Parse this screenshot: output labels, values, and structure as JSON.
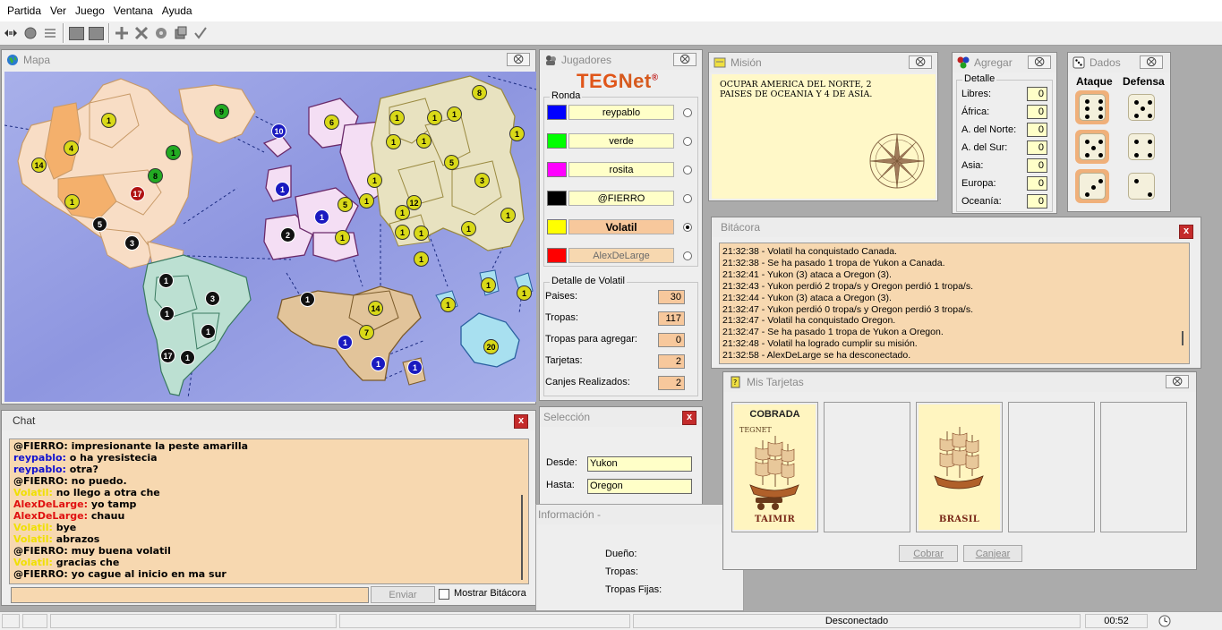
{
  "menu": [
    "Partida",
    "Ver",
    "Juego",
    "Ventana",
    "Ayuda"
  ],
  "toolbar": {
    "buttons": [
      "connect-icon",
      "start-icon",
      "list-icon",
      "stop-icon",
      "stop2-icon",
      "add-icon",
      "cancel-icon",
      "settings-icon",
      "copy-icon",
      "check-icon"
    ]
  },
  "map": {
    "title": "Mapa",
    "close_label": "⨂",
    "armies": [
      {
        "n": "1",
        "c": "y"
      },
      {
        "n": "9",
        "c": "g"
      },
      {
        "n": "4",
        "c": "y"
      },
      {
        "n": "14",
        "c": "y"
      },
      {
        "n": "1",
        "c": "g"
      },
      {
        "n": "8",
        "c": "g"
      },
      {
        "n": "1",
        "c": "y"
      },
      {
        "n": "17",
        "c": "r"
      },
      {
        "n": "5",
        "c": "k"
      },
      {
        "n": "3",
        "c": "k"
      },
      {
        "n": "10",
        "c": "b"
      },
      {
        "n": "1",
        "c": "b"
      },
      {
        "n": "6",
        "c": "y"
      },
      {
        "n": "1",
        "c": "y"
      },
      {
        "n": "1",
        "c": "y"
      },
      {
        "n": "1",
        "c": "y"
      },
      {
        "n": "8",
        "c": "y"
      },
      {
        "n": "1",
        "c": "y"
      },
      {
        "n": "1",
        "c": "y"
      },
      {
        "n": "1",
        "c": "y"
      },
      {
        "n": "5",
        "c": "y"
      },
      {
        "n": "1",
        "c": "y"
      },
      {
        "n": "3",
        "c": "y"
      },
      {
        "n": "12",
        "c": "y"
      },
      {
        "n": "1",
        "c": "y"
      },
      {
        "n": "5",
        "c": "y"
      },
      {
        "n": "1",
        "c": "y"
      },
      {
        "n": "1",
        "c": "b"
      },
      {
        "n": "1",
        "c": "y"
      },
      {
        "n": "1",
        "c": "y"
      },
      {
        "n": "1",
        "c": "y"
      },
      {
        "n": "1",
        "c": "y"
      },
      {
        "n": "1",
        "c": "y"
      },
      {
        "n": "2",
        "c": "k"
      },
      {
        "n": "1",
        "c": "y"
      },
      {
        "n": "1",
        "c": "k"
      },
      {
        "n": "3",
        "c": "k"
      },
      {
        "n": "1",
        "c": "k"
      },
      {
        "n": "1",
        "c": "k"
      },
      {
        "n": "17",
        "c": "k"
      },
      {
        "n": "1",
        "c": "k"
      },
      {
        "n": "1",
        "c": "k"
      },
      {
        "n": "14",
        "c": "y"
      },
      {
        "n": "7",
        "c": "y"
      },
      {
        "n": "1",
        "c": "b"
      },
      {
        "n": "1",
        "c": "b"
      },
      {
        "n": "1",
        "c": "b"
      },
      {
        "n": "1",
        "c": "y"
      },
      {
        "n": "1",
        "c": "y"
      },
      {
        "n": "1",
        "c": "y"
      },
      {
        "n": "20",
        "c": "y"
      }
    ]
  },
  "chat": {
    "title": "Chat",
    "close_label": "x",
    "lines": [
      {
        "nick": "@FIERRO:",
        "color": "#000000",
        "text": " impresionante la peste amarilla"
      },
      {
        "nick": "reypablo:",
        "color": "#1010d0",
        "text": " o ha yresistecia"
      },
      {
        "nick": "reypablo:",
        "color": "#1010d0",
        "text": " otra?"
      },
      {
        "nick": "@FIERRO:",
        "color": "#000000",
        "text": " no puedo."
      },
      {
        "nick": "Volatil:",
        "color": "#f0e000",
        "text": " no llego a otra che"
      },
      {
        "nick": "AlexDeLarge:",
        "color": "#e01010",
        "text": " yo tamp"
      },
      {
        "nick": "AlexDeLarge:",
        "color": "#e01010",
        "text": " chauu"
      },
      {
        "nick": "Volatil:",
        "color": "#f0e000",
        "text": " bye"
      },
      {
        "nick": "Volatil:",
        "color": "#f0e000",
        "text": " abrazos"
      },
      {
        "nick": "@FIERRO:",
        "color": "#000000",
        "text": " muy buena volatil"
      },
      {
        "nick": "Volatil:",
        "color": "#f0e000",
        "text": " gracias che"
      },
      {
        "nick": "@FIERRO:",
        "color": "#000000",
        "text": " yo cague al inicio en ma sur"
      }
    ],
    "input_value": "",
    "send_label": "Enviar",
    "show_log_label": "Mostrar Bitácora"
  },
  "players": {
    "title": "Jugadores",
    "close_label": "⨂",
    "logo_teg": "TEG",
    "logo_net": "Net",
    "logo_mark": "®",
    "round_label": "Ronda",
    "list": [
      {
        "name": "reypablo",
        "color": "#0000ff",
        "style": "normal",
        "selected": false
      },
      {
        "name": "verde",
        "color": "#00ff00",
        "style": "normal",
        "selected": false
      },
      {
        "name": "rosita",
        "color": "#ff00ff",
        "style": "normal",
        "selected": false
      },
      {
        "name": "@FIERRO",
        "color": "#000000",
        "style": "normal",
        "selected": false
      },
      {
        "name": "Volatil",
        "color": "#ffff00",
        "style": "active",
        "selected": true
      },
      {
        "name": "AlexDeLarge",
        "color": "#ff0000",
        "style": "dim",
        "selected": false
      }
    ],
    "detail_label": "Detalle de Volatil",
    "detail": [
      {
        "label": "Paises:",
        "value": "30"
      },
      {
        "label": "Tropas:",
        "value": "117"
      },
      {
        "label": "Tropas para agregar:",
        "value": "0"
      },
      {
        "label": "Tarjetas:",
        "value": "2"
      },
      {
        "label": "Canjes Realizados:",
        "value": "2"
      }
    ]
  },
  "selection": {
    "title": "Selección",
    "close_label": "x",
    "from_label": "Desde:",
    "from_value": "Yukon",
    "to_label": "Hasta:",
    "to_value": "Oregon"
  },
  "info": {
    "title": "Información -",
    "owner_label": "Dueño:",
    "troops_label": "Tropas:",
    "fixed_label": "Tropas Fijas:"
  },
  "mission": {
    "title": "Misión",
    "close_label": "⨂",
    "text": "OCUPAR AMERICA DEL NORTE, 2 PAISES DE OCEANIA Y 4 DE ASIA."
  },
  "add": {
    "title": "Agregar",
    "close_label": "⨂",
    "detail_label": "Detalle",
    "rows": [
      {
        "label": "Libres:",
        "value": "0"
      },
      {
        "label": "África:",
        "value": "0"
      },
      {
        "label": "A. del Norte:",
        "value": "0"
      },
      {
        "label": "A. del Sur:",
        "value": "0"
      },
      {
        "label": "Asia:",
        "value": "0"
      },
      {
        "label": "Europa:",
        "value": "0"
      },
      {
        "label": "Oceanía:",
        "value": "0"
      }
    ]
  },
  "dice": {
    "title": "Dados",
    "close_label": "⨂",
    "attack_label": "Ataque",
    "defense_label": "Defensa",
    "attack": [
      6,
      5,
      3
    ],
    "defense": [
      5,
      4,
      2
    ]
  },
  "log": {
    "title": "Bitácora",
    "close_label": "x",
    "lines": [
      "21:32:38 - Volatil ha conquistado Canada.",
      "21:32:38 - Se ha pasado 1 tropa de Yukon a Canada.",
      "21:32:41 - Yukon (3) ataca a Oregon (3).",
      "21:32:43 - Yukon perdió 2 tropa/s y Oregon perdió 1 tropa/s.",
      "21:32:44 - Yukon (3) ataca a Oregon (3).",
      "21:32:47 - Yukon perdió 0 tropa/s y Oregon perdió 3 tropa/s.",
      "21:32:47 - Volatil ha conquistado Oregon.",
      "21:32:47 - Se ha pasado 1 tropa de Yukon a Oregon.",
      "21:32:48 - Volatil ha logrado cumplir su misión.",
      "21:32:58 - AlexDeLarge se ha desconectado."
    ]
  },
  "cards": {
    "title": "Mis Tarjetas",
    "close_label": "⨂",
    "items": [
      {
        "status": "COBRADA",
        "country": "TAIMIR",
        "brand": "TEGNET",
        "image": "ship-cannon"
      },
      null,
      {
        "status": "",
        "country": "BRASIL",
        "brand": "",
        "image": "ship"
      },
      null,
      null
    ],
    "collect_label": "Cobrar",
    "exchange_label": "Canjear"
  },
  "status": {
    "connection": "Desconectado",
    "time": "00:52"
  }
}
